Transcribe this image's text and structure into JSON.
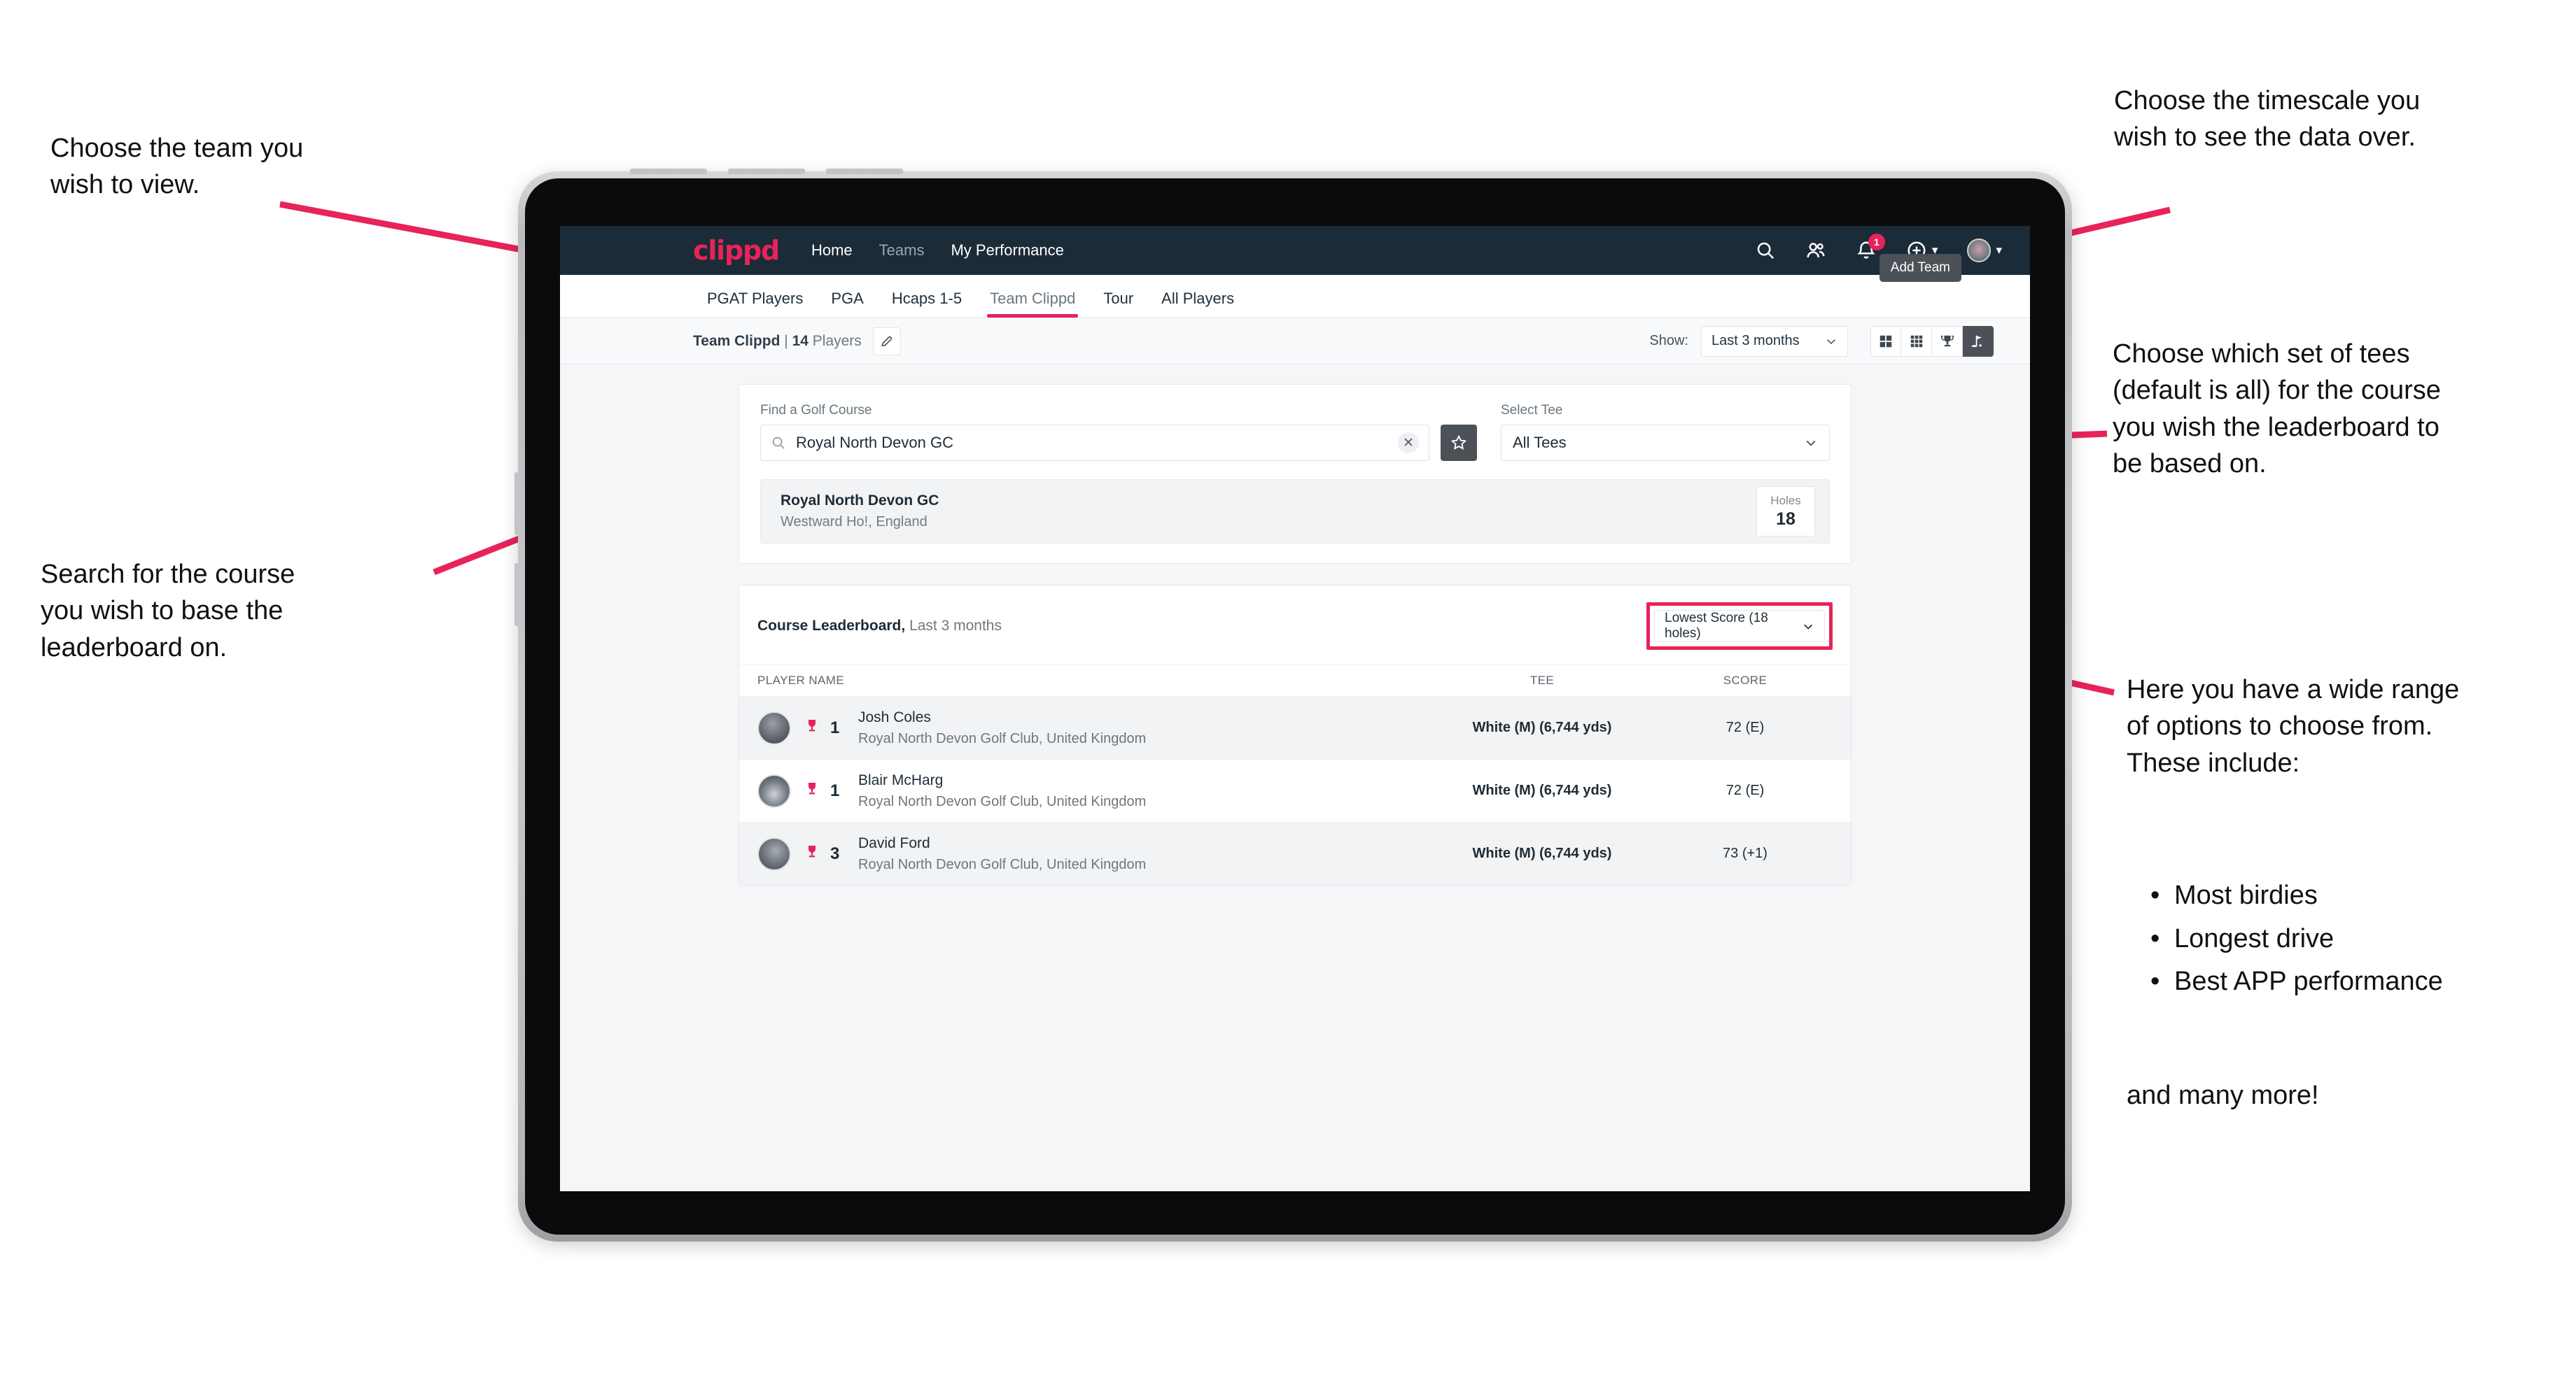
{
  "annotations": {
    "team": "Choose the team you\nwish to view.",
    "timescale": "Choose the timescale you\nwish to see the data over.",
    "tees": "Choose which set of tees\n(default is all) for the course\nyou wish the leaderboard to\nbe based on.",
    "search": "Search for the course\nyou wish to base the\nleaderboard on.",
    "options_intro": "Here you have a wide range\nof options to choose from.\nThese include:",
    "options_list": [
      "Most birdies",
      "Longest drive",
      "Best APP performance"
    ],
    "options_outro": "and many more!"
  },
  "navbar": {
    "brand": "clippd",
    "links": [
      {
        "label": "Home",
        "dim": false
      },
      {
        "label": "Teams",
        "dim": true
      },
      {
        "label": "My Performance",
        "dim": false
      }
    ],
    "icons": [
      "search-icon",
      "people-icon",
      "bell-icon",
      "plus-circle-icon",
      "avatar-icon"
    ],
    "notification_count": "1"
  },
  "tabs": {
    "items": [
      {
        "label": "PGAT Players",
        "active": false
      },
      {
        "label": "PGA",
        "active": false
      },
      {
        "label": "Hcaps 1-5",
        "active": false
      },
      {
        "label": "Team Clippd",
        "active": true
      },
      {
        "label": "Tour",
        "active": false
      },
      {
        "label": "All Players",
        "active": false
      }
    ],
    "tooltip": "Add Team"
  },
  "subbar": {
    "team_name": "Team Clippd",
    "separator": " | ",
    "player_count": "14",
    "players_word": " Players",
    "edit_icon": "pencil-icon",
    "show_label": "Show:",
    "show_value": "Last 3 months",
    "toggles": [
      {
        "icon": "grid-4-icon",
        "active": false
      },
      {
        "icon": "grid-9-icon",
        "active": false
      },
      {
        "icon": "trophy-icon",
        "active": false
      },
      {
        "icon": "golf-flag-icon",
        "active": true
      }
    ]
  },
  "search_panel": {
    "course_label": "Find a Golf Course",
    "course_value": "Royal North Devon GC",
    "clear_icon": "close-icon",
    "star_icon": "star-icon",
    "tee_label": "Select Tee",
    "tee_value": "All Tees"
  },
  "course_result": {
    "name": "Royal North Devon GC",
    "location": "Westward Ho!, England",
    "holes_label": "Holes",
    "holes_value": "18"
  },
  "leaderboard": {
    "title": "Course Leaderboard,",
    "subtitle": " Last 3 months",
    "sort_value": "Lowest Score (18 holes)",
    "columns": {
      "player": "PLAYER NAME",
      "tee": "TEE",
      "score": "SCORE"
    },
    "rows": [
      {
        "rank": "1",
        "name": "Josh Coles",
        "club": "Royal North Devon Golf Club, United Kingdom",
        "tee": "White (M) (6,744 yds)",
        "score": "72 (E)"
      },
      {
        "rank": "1",
        "name": "Blair McHarg",
        "club": "Royal North Devon Golf Club, United Kingdom",
        "tee": "White (M) (6,744 yds)",
        "score": "72 (E)"
      },
      {
        "rank": "3",
        "name": "David Ford",
        "club": "Royal North Devon Golf Club, United Kingdom",
        "tee": "White (M) (6,744 yds)",
        "score": "73 (+1)"
      }
    ]
  },
  "colors": {
    "accent_pink": "#e8235a",
    "navbar_dark": "#1c2b38",
    "toggle_active": "#4b5157"
  }
}
